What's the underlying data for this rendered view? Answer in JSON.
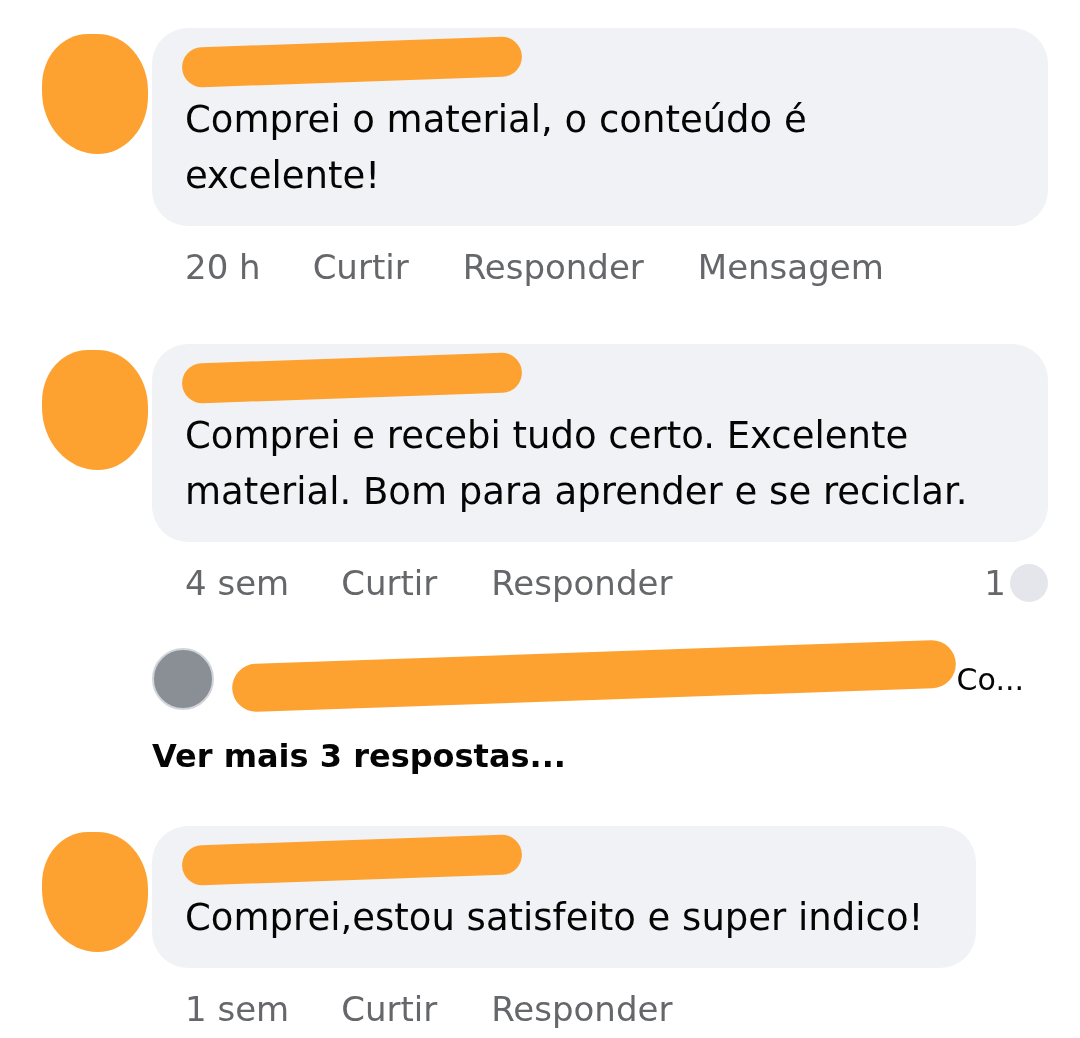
{
  "comments": [
    {
      "text": "Comprei o material, o conteúdo é excelente!",
      "time": "20 h",
      "actions": [
        "Curtir",
        "Responder",
        "Mensagem"
      ]
    },
    {
      "text": "Comprei e recebi tudo certo. Excelente material. Bom para aprender e se reciclar.",
      "time": "4 sem",
      "actions": [
        "Curtir",
        "Responder"
      ],
      "reaction_count": "1",
      "replies": [
        {
          "text": "Co..."
        }
      ],
      "more_replies": "Ver mais 3 respostas..."
    },
    {
      "text": "Comprei,estou satisfeito e super indico!",
      "time": "1 sem",
      "actions": [
        "Curtir",
        "Responder"
      ]
    }
  ]
}
